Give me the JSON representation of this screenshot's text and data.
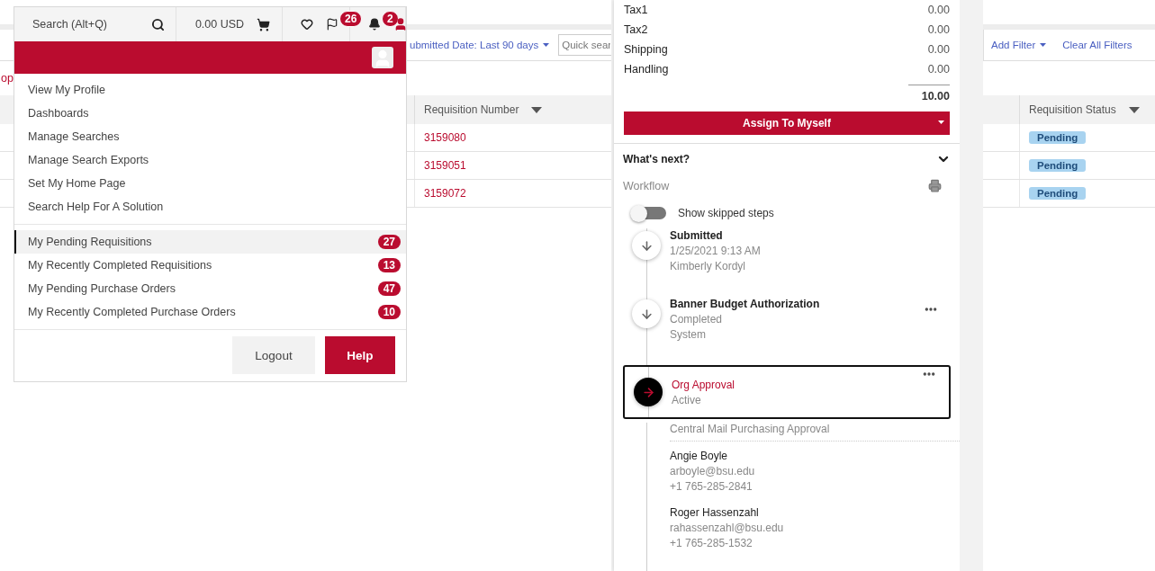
{
  "header": {
    "search": "Search (Alt+Q)",
    "cart_total": "0.00 USD",
    "flag_badge": "26",
    "bell_badge": "2"
  },
  "user_menu": {
    "links": [
      "View My Profile",
      "Dashboards",
      "Manage Searches",
      "Manage Search Exports",
      "Set My Home Page",
      "Search Help For A Solution"
    ],
    "counters": [
      {
        "label": "My Pending Requisitions",
        "count": "27",
        "selected": true
      },
      {
        "label": "My Recently Completed Requisitions",
        "count": "13",
        "selected": false
      },
      {
        "label": "My Pending Purchase Orders",
        "count": "47",
        "selected": false
      },
      {
        "label": "My Recently Completed Purchase Orders",
        "count": "10",
        "selected": false
      }
    ],
    "buttons": [
      {
        "label": "Logout",
        "kind": "secondary"
      },
      {
        "label": "Help",
        "kind": "primary"
      }
    ]
  },
  "list": {
    "cut_link": "op",
    "date_filter": "ubmitted Date: Last 90 days",
    "quick_search": {
      "placeholder": "Quick sear"
    },
    "add_filter": "Add Filter",
    "clear_filters": "Clear All Filters",
    "columns": [
      {
        "label": "Requisition Number"
      },
      {
        "label": "Requisition Status"
      }
    ],
    "rows": [
      {
        "number": "3159080",
        "status": "Pending"
      },
      {
        "number": "3159051",
        "status": "Pending"
      },
      {
        "number": "3159072",
        "status": "Pending"
      }
    ]
  },
  "summary": {
    "lines": [
      {
        "label": "Tax1",
        "value": "0.00"
      },
      {
        "label": "Tax2",
        "value": "0.00"
      },
      {
        "label": "Shipping",
        "value": "0.00"
      },
      {
        "label": "Handling",
        "value": "0.00"
      }
    ],
    "total": "10.00",
    "action": "Assign To Myself"
  },
  "whats_next": {
    "title": "What's next?",
    "expanded": true,
    "workflow_label": "Workflow",
    "show_skipped": {
      "label": "Show skipped steps",
      "on": false
    },
    "steps": [
      {
        "kind": "done",
        "title": "Submitted",
        "lines": [
          "1/25/2021 9:13 AM",
          "Kimberly Kordyl"
        ],
        "has_menu": false
      },
      {
        "kind": "done",
        "title": "Banner Budget Authorization",
        "lines": [
          "Completed",
          "System"
        ],
        "has_menu": true
      },
      {
        "kind": "active",
        "title": "Org Approval",
        "lines": [
          "Active"
        ],
        "has_menu": true
      }
    ],
    "approval_group": "Central Mail Purchasing Approval",
    "approvers": [
      {
        "name": "Angie Boyle",
        "email": "arboyle@bsu.edu",
        "phone": "+1 765-285-2841"
      },
      {
        "name": "Roger Hassenzahl",
        "email": "rahassenzahl@bsu.edu",
        "phone": "+1 765-285-1532"
      }
    ]
  }
}
